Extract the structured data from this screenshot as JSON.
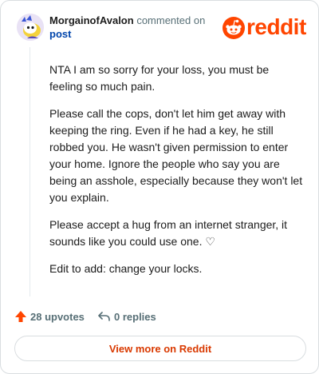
{
  "header": {
    "author": "MorgainofAvalon",
    "action_text": "commented on",
    "target_link": "post",
    "brand_wordmark": "reddit",
    "brand_color": "#ff4500"
  },
  "avatar": {
    "icon": "snoo-avatar-icon",
    "background": "#e9e2f5"
  },
  "comment": {
    "paragraphs": [
      "NTA I am so sorry for your loss, you must be feeling so much pain.",
      "Please call the cops, don't let him get away with keeping the ring. Even if he had a key, he still robbed you. He wasn't given permission to enter your home. Ignore the people who say you are being an asshole, especially because they won't let you explain.",
      "Please accept a hug from an internet stranger, it sounds like you could use one. ♡",
      "Edit to add: change your locks."
    ]
  },
  "actions": {
    "upvotes": "28 upvotes",
    "upvote_icon": "upvote-arrow-icon",
    "upvote_color": "#ff4500",
    "replies": "0 replies",
    "reply_icon": "reply-arrow-icon"
  },
  "footer": {
    "view_more": "View more on Reddit"
  }
}
